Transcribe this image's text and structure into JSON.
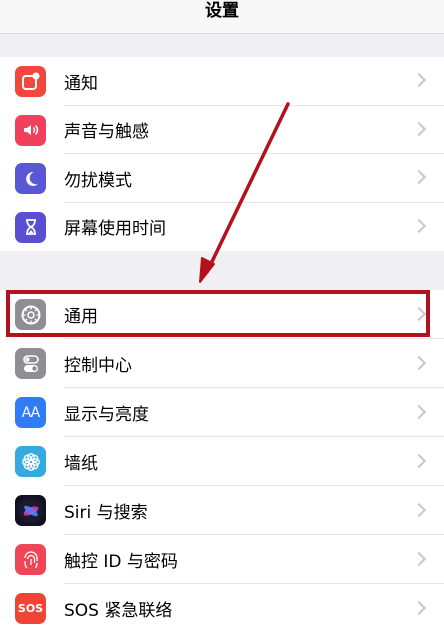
{
  "header": {
    "title": "设置"
  },
  "groups": [
    {
      "items": [
        {
          "label": "通知",
          "icon": "notification-icon",
          "color": "#f2473d"
        },
        {
          "label": "声音与触感",
          "icon": "speaker-icon",
          "color": "#f0405c"
        },
        {
          "label": "勿扰模式",
          "icon": "moon-icon",
          "color": "#5a57d6"
        },
        {
          "label": "屏幕使用时间",
          "icon": "hourglass-icon",
          "color": "#5a4fd1"
        }
      ]
    },
    {
      "items": [
        {
          "label": "通用",
          "icon": "gear-icon",
          "color": "#8e8e93"
        },
        {
          "label": "控制中心",
          "icon": "toggle-icon",
          "color": "#8e8e93"
        },
        {
          "label": "显示与亮度",
          "icon": "text-size-icon",
          "color": "#2f7cf6",
          "glyph": "AA"
        },
        {
          "label": "墙纸",
          "icon": "flower-icon",
          "color": "#36a9e1"
        },
        {
          "label": "Siri 与搜索",
          "icon": "siri-icon",
          "color": "#1c1c2e"
        },
        {
          "label": "触控 ID 与密码",
          "icon": "fingerprint-icon",
          "color": "#f04556"
        },
        {
          "label": "SOS 紧急联络",
          "icon": "sos-icon",
          "color": "#f04536",
          "glyph": "SOS"
        }
      ]
    }
  ],
  "annotation": {
    "highlight_color": "#b3121d",
    "highlighted_item": "通用"
  }
}
